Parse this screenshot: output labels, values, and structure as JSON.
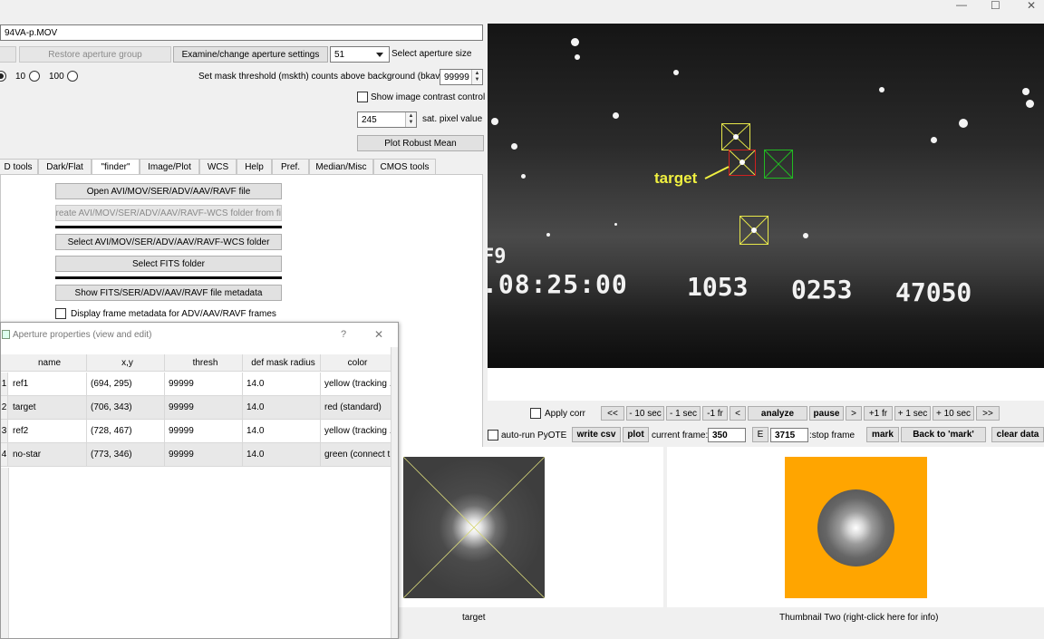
{
  "window": {
    "title": "94VA-p.MOV"
  },
  "buttons": {
    "restore_aperture": "Restore aperture group",
    "examine_aperture": "Examine/change aperture settings",
    "plot_robust_mean": "Plot Robust Mean",
    "open_file": "Open AVI/MOV/SER/ADV/AAV/RAVF file",
    "create_wcs_folder": "Create AVI/MOV/SER/ADV/AAV/RAVF-WCS folder from file",
    "select_wcs_folder": "Select AVI/MOV/SER/ADV/AAV/RAVF-WCS folder",
    "select_fits": "Select FITS folder",
    "show_metadata": "Show FITS/SER/ADV/AAV/RAVF file metadata"
  },
  "aperture_size": {
    "value": "51",
    "label": "Select aperture size"
  },
  "radios": [
    {
      "label": "10"
    },
    {
      "label": "100"
    }
  ],
  "mask": {
    "label": "Set mask threshold (mskth) counts above background (bkavg)",
    "value": "99999"
  },
  "contrast": {
    "label": "Show image contrast control"
  },
  "sat": {
    "value": "245",
    "label": "sat. pixel value"
  },
  "tabs": [
    "D tools",
    "Dark/Flat",
    "\"finder\"",
    "Image/Plot",
    "WCS",
    "Help",
    "Pref.",
    "Median/Misc",
    "CMOS tools"
  ],
  "frame_meta_label": "Display frame metadata for ADV/AAV/RAVF frames",
  "dialog": {
    "title": "Aperture properties (view and edit)",
    "help": "?",
    "close": "✕",
    "columns": [
      "name",
      "x,y",
      "thresh",
      "def mask radius",
      "color"
    ],
    "rows": [
      {
        "num": "1",
        "name": "ref1",
        "xy": "(694, 295)",
        "thresh": "99999",
        "radius": "14.0",
        "color": "yellow (tracking ..."
      },
      {
        "num": "2",
        "name": "target",
        "xy": "(706, 343)",
        "thresh": "99999",
        "radius": "14.0",
        "color": "red (standard)"
      },
      {
        "num": "3",
        "name": "ref2",
        "xy": "(728, 467)",
        "thresh": "99999",
        "radius": "14.0",
        "color": "yellow (tracking ..."
      },
      {
        "num": "4",
        "name": "no-star",
        "xy": "(773, 346)",
        "thresh": "99999",
        "radius": "14.0",
        "color": "green (connect t..."
      }
    ]
  },
  "image": {
    "target_label": "target",
    "overlay_time": ".08:25:00",
    "overlay_n1": "1053",
    "overlay_n2": "0253",
    "overlay_n3": "47050",
    "overlay_top": "F9"
  },
  "playback": {
    "apply_corr": "Apply corr",
    "first": "<<",
    "back10": "- 10 sec",
    "back1": "- 1 sec",
    "back_fr": "-1 fr",
    "prev": "<",
    "analyze": "analyze",
    "pause": "pause",
    "next": ">",
    "fwd_fr": "+1 fr",
    "fwd1": "+ 1 sec",
    "fwd10": "+ 10 sec",
    "last": ">>",
    "auto_run": "auto-run PyOTE",
    "write_csv": "write csv",
    "plot": "plot",
    "current_frame_label": "current frame:",
    "current_frame": "350",
    "e_btn": "E",
    "stop_frame": "3715",
    "stop_frame_label": ":stop frame",
    "mark": "mark",
    "back_to_mark": "Back to 'mark'",
    "clear_data": "clear data"
  },
  "thumbnails": {
    "one_label": "target",
    "two_label": "Thumbnail Two (right-click here for info)"
  },
  "window_controls": {
    "min": "—",
    "max": "☐",
    "close": "✕"
  },
  "colors": {
    "yellow": "#e8e84a",
    "red": "#d02020",
    "green": "#22bb22",
    "orange": "#ffa500",
    "target_text": "#f0f040"
  }
}
